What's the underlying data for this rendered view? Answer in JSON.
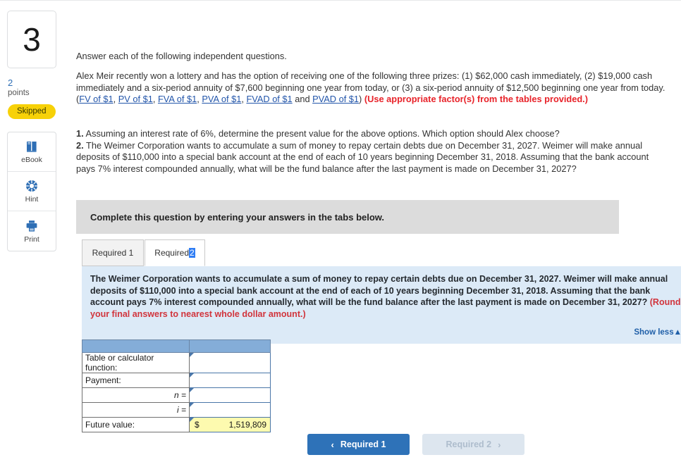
{
  "question": {
    "number": "3",
    "points_value": "2",
    "points_label": "points",
    "status_badge": "Skipped"
  },
  "tools": [
    {
      "name": "ebook",
      "label": "eBook",
      "icon": "book-icon"
    },
    {
      "name": "hint",
      "label": "Hint",
      "icon": "lifebuoy-icon"
    },
    {
      "name": "print",
      "label": "Print",
      "icon": "printer-icon"
    }
  ],
  "content": {
    "intro": "Answer each of the following independent questions.",
    "prizes": {
      "text_before_links": "Alex Meir recently won a lottery and has the option of receiving one of the following three prizes: (1) $62,000 cash immediately, (2) $19,000 cash immediately and a six-period annuity of $7,600 beginning one year from today, or (3) a six-period annuity of $12,500 beginning one year from today. (",
      "links": [
        "FV of $1",
        "PV of $1",
        "FVA of $1",
        "PVA of $1",
        "FVAD of $1",
        "PVAD of $1"
      ],
      "link_separator": ", ",
      "link_conjunction": " and ",
      "text_after_links": ")",
      "emphasis": " (Use appropriate factor(s) from the tables provided.)"
    },
    "requirements": [
      {
        "marker": "1.",
        "text": " Assuming an interest rate of 6%, determine the present value for the above options. Which option should Alex choose?"
      },
      {
        "marker": "2.",
        "text": " The Weimer Corporation wants to accumulate a sum of money to repay certain debts due on December 31, 2027. Weimer will make annual deposits of $110,000 into a special bank account at the end of each of 10 years beginning December 31, 2018. Assuming that the bank account pays 7% interest compounded annually, what will be the fund balance after the last payment is made on December 31, 2027?"
      }
    ]
  },
  "banner": {
    "text": "Complete this question by entering your answers in the tabs below."
  },
  "tabs": [
    {
      "name": "required-1",
      "label": "Required 1",
      "active": false
    },
    {
      "name": "required-2",
      "label_prefix": "Required ",
      "label_selected": "2",
      "active": true
    }
  ],
  "infobox": {
    "body": "The Weimer Corporation wants to accumulate a sum of money to repay certain debts due on December 31, 2027. Weimer will make annual deposits of $110,000 into a special bank account at the end of each of 10 years beginning December 31, 2018. Assuming that the bank account pays 7% interest compounded annually, what will be the fund balance after the last payment is made on December 31, 2027? ",
    "rounding_note": "(Round your final answers to nearest whole dollar amount.)",
    "show_less_label": "Show less",
    "show_less_caret": "▲"
  },
  "answer_table": {
    "rows": [
      {
        "label": "Table or calculator function:",
        "label_align": "left",
        "value": "",
        "highlighted": false
      },
      {
        "label": "Payment:",
        "label_align": "left",
        "value": "",
        "highlighted": false
      },
      {
        "label": "n =",
        "label_align": "right",
        "value": "",
        "highlighted": false
      },
      {
        "label": "i =",
        "label_align": "right",
        "value": "",
        "highlighted": false
      },
      {
        "label": "Future value:",
        "label_align": "left",
        "value": "1,519,809",
        "currency": "$",
        "highlighted": true
      }
    ]
  },
  "nav": {
    "prev_label": "Required 1",
    "prev_chevron": "‹",
    "next_label": "Required 2",
    "next_chevron": "›"
  },
  "colors": {
    "accent_blue": "#2e72b8",
    "banner_gray": "#dcdcdc",
    "info_blue": "#dceaf7",
    "table_header_blue": "#84add8",
    "answer_yellow": "#fdfaaf",
    "badge_yellow": "#f7d108",
    "red_emphasis": "#e8232a",
    "link_blue": "#2255aa"
  }
}
